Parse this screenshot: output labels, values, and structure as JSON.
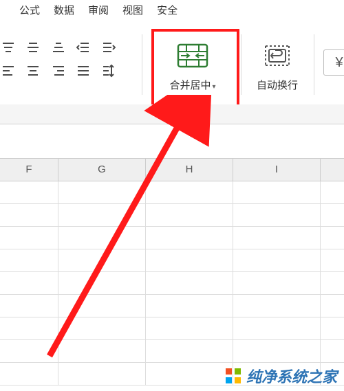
{
  "menu": {
    "formula": "公式",
    "data": "数据",
    "review": "审阅",
    "view": "视图",
    "security": "安全"
  },
  "ribbon": {
    "merge": {
      "label": "合并居中"
    },
    "wrap": {
      "label": "自动换行"
    },
    "extraGlyph": "¥"
  },
  "columns": [
    "F",
    "G",
    "H",
    "I"
  ],
  "watermark": "纯净系统之家"
}
